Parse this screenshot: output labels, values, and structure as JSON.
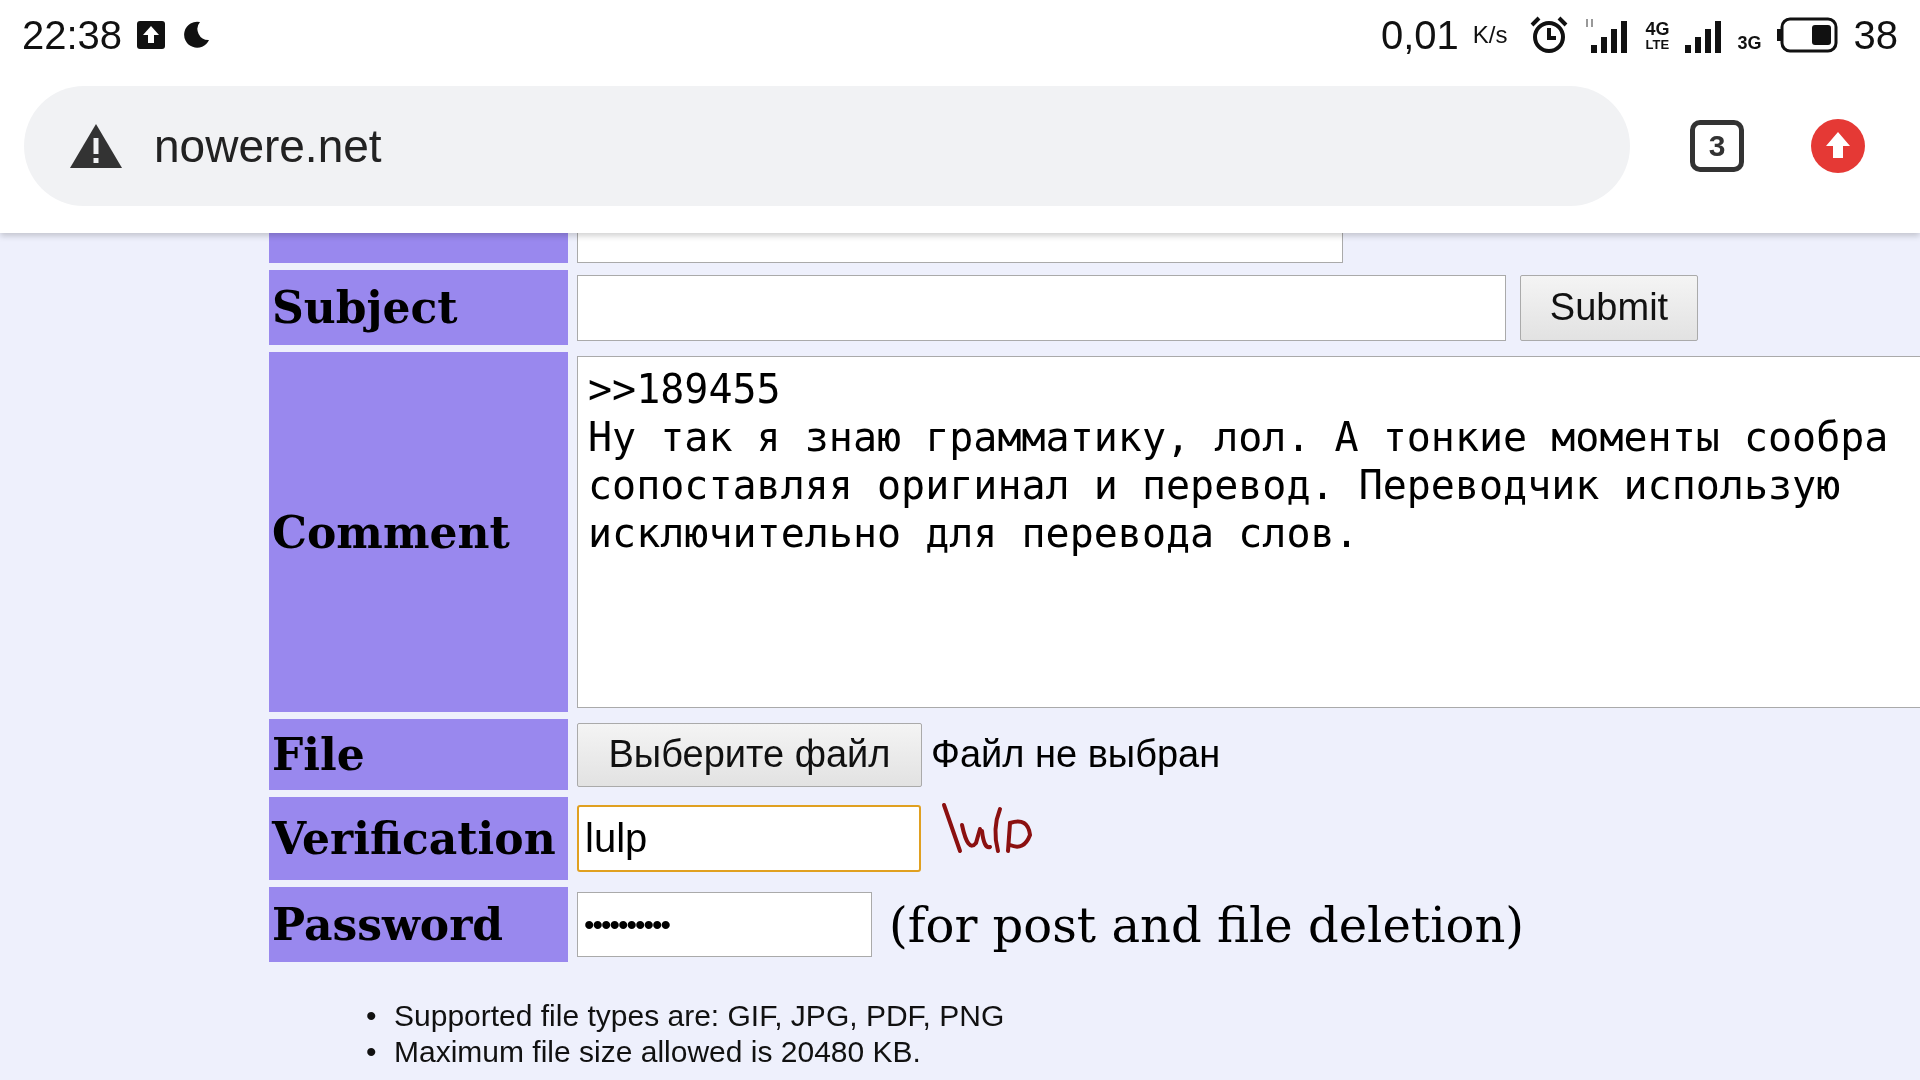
{
  "status_bar": {
    "time": "22:38",
    "net_speed": "0,01",
    "speed_unit": "K/s",
    "network_1": "4G",
    "network_1_sub": "LTE",
    "network_2": "3G",
    "battery": "38"
  },
  "browser": {
    "url": "nowere.net",
    "tab_count": "3"
  },
  "form": {
    "rows": [
      {
        "kind": "hidden_row"
      },
      {
        "kind": "subject",
        "label": "Subject",
        "button": "Submit"
      },
      {
        "kind": "comment",
        "label": "Comment",
        "lines": [
          ">>189455",
          "Ну так я знаю грамматику, лол. А тонкие моменты сообра",
          "сопоставляя оригинал и перевод. Переводчик использую",
          "исключительно для перевода слов."
        ]
      },
      {
        "kind": "file",
        "label": "File",
        "button": "Выберите файл",
        "status": "Файл не выбран"
      },
      {
        "kind": "captcha",
        "label": "Verification",
        "value": "lulp",
        "focused": true
      },
      {
        "kind": "password",
        "label": "Password",
        "value": "••••••••••",
        "note": "(for post and file deletion)"
      }
    ],
    "notes": [
      {
        "bullet": "•",
        "text": "Supported file types are: GIF, JPG, PDF, PNG"
      },
      {
        "bullet": "•",
        "text": "Maximum file size allowed is 20480 KB."
      }
    ]
  }
}
